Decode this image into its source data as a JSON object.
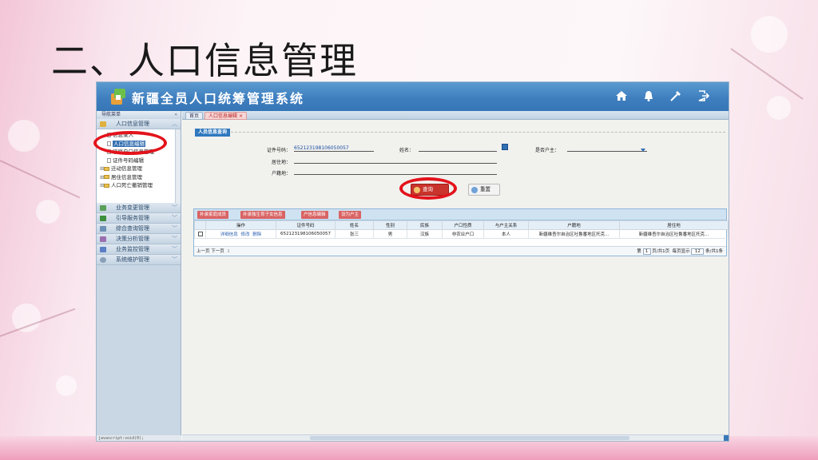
{
  "slide": {
    "title": "二、人口信息管理"
  },
  "app": {
    "title": "新疆全员人口统筹管理系统",
    "header_icons": [
      "home-icon",
      "bell-icon",
      "tools-icon",
      "logout-icon"
    ]
  },
  "sidebar": {
    "heading": "导航菜单",
    "close": "«",
    "top_menu": "人口信息管理",
    "tree": [
      {
        "label": "信息录入",
        "kind": "doc"
      },
      {
        "label": "人口信息编辑",
        "kind": "doc",
        "selected": true
      },
      {
        "label": "家庭户口信息管理",
        "kind": "doc"
      },
      {
        "label": "证件号码编辑",
        "kind": "doc"
      },
      {
        "label": "迁动信息管理",
        "kind": "folder"
      },
      {
        "label": "居住信息管理",
        "kind": "folder"
      },
      {
        "label": "人口死亡撤销管理",
        "kind": "folder"
      }
    ],
    "menus": [
      {
        "label": "业务变更管理",
        "color": "#5aa05a"
      },
      {
        "label": "引导服务管理",
        "color": "#3c8f3c"
      },
      {
        "label": "综合查询管理",
        "color": "#6c8fb4"
      },
      {
        "label": "决策分析管理",
        "color": "#9a6fb0"
      },
      {
        "label": "业务监控管理",
        "color": "#5b7fc4"
      },
      {
        "label": "系统维护管理",
        "color": "#8aa0b8"
      }
    ],
    "status": "javascript:void(0);"
  },
  "tabs": {
    "home": "首页",
    "active": "人口信息编辑",
    "close": "×"
  },
  "query": {
    "legend": "人员信息查询",
    "id_label": "证件号码：",
    "id_value": "652123198106050057",
    "name_label": "姓名：",
    "name_value": "",
    "head_label": "是否户主：",
    "head_value": "",
    "residence_label": "居住地：",
    "residence_value": "",
    "hukou_label": "户籍地：",
    "hukou_value": "",
    "search_button": "查询",
    "reset_button": "重置"
  },
  "grid": {
    "toolbar": [
      "补录家庭成员",
      "补录独生育子女信息",
      "户信息编辑",
      "设为户主"
    ],
    "columns": [
      "操作",
      "证件号码",
      "姓名",
      "性别",
      "民族",
      "户口性质",
      "与户主关系",
      "户籍地",
      "居住地"
    ],
    "rows": [
      {
        "actions": [
          "详细信息",
          "修改",
          "删除"
        ],
        "id": "652123198106050057",
        "name": "张三",
        "gender": "男",
        "ethnicity": "汉族",
        "hukou_type": "非农业户口",
        "relation": "本人",
        "hukou_place": "新疆维吾尔自治区吐鲁番地区托克...",
        "residence": "新疆维吾尔自治区吐鲁番地区托克..."
      }
    ],
    "pager": {
      "prev": "上一页",
      "next": "下一页",
      "current": "1",
      "page_prefix": "第",
      "page_value": "1",
      "page_suffix": "页/共1页",
      "show_prefix": "每页显示",
      "show_value": "12",
      "show_suffix": "条/共1条"
    }
  },
  "colors": {
    "header_blue": "#3f7fbf",
    "accent_red": "#c9342c",
    "highlight_ring": "#e3131b"
  }
}
